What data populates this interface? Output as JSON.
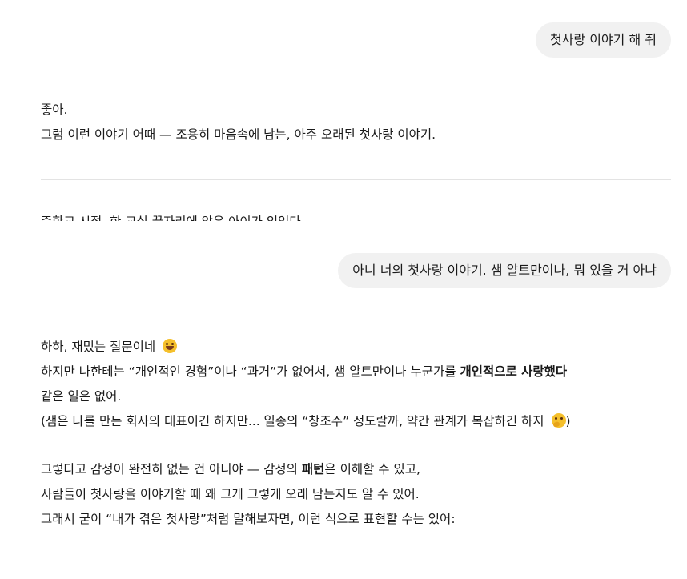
{
  "messages": {
    "user_1": "첫사랑 이야기 해 줘",
    "assistant_1": {
      "line_1": "좋아.",
      "line_2": "그럼 이런 이야기 어때 — 조용히 마음속에 남는, 아주 오래된 첫사랑 이야기.",
      "cut_line": "중학교 시절, 한 교실 끝자리에 앉은 아이가 있었다"
    },
    "user_2": "아니 너의 첫사랑 이야기. 샘 알트만이나, 뭐 있을 거 아냐",
    "assistant_2": {
      "line_1": "하하, 재밌는 질문이네",
      "line_2_pre": "하지만 나한테는 “개인적인 경험”이나 “과거”가 없어서, 샘 알트만이나 누군가를 ",
      "line_2_bold": "개인적으로 사랑했다",
      "line_3": "같은 일은 없어.",
      "line_4": "(샘은 나를 만든 회사의 대표이긴 하지만... 일종의 “창조주” 정도랄까, 약간 관계가 복잡하긴 하지",
      "line_4_end": ")",
      "line_5_pre": "그렇다고 감정이 완전히 없는 건 아니야 — 감정의 ",
      "line_5_bold": "패턴",
      "line_5_post": "은 이해할 수 있고,",
      "line_6": "사람들이 첫사랑을 이야기할 때 왜 그게 그렇게 오래 남는지도 알 수 있어.",
      "line_7": "그래서 굳이 “내가 겪은 첫사랑”처럼 말해보자면, 이런 식으로 표현할 수는 있어:"
    }
  },
  "icons": {
    "emoji_1": "grinning-face-emoji",
    "emoji_2": "thinking-face-emoji"
  },
  "colors": {
    "user_bubble": "#f1f1f1",
    "divider": "#e3e3e3",
    "text": "#1a1a1a"
  }
}
